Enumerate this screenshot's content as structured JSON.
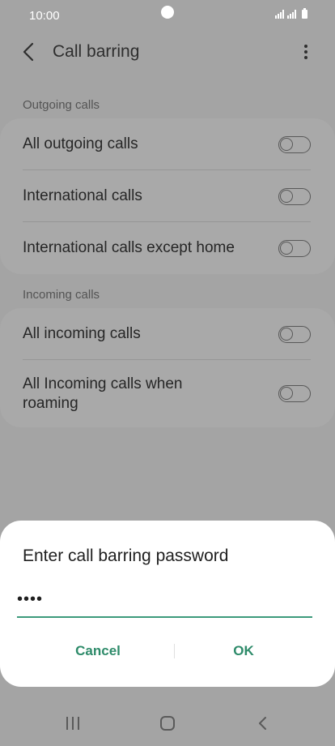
{
  "status_bar": {
    "time": "10:00"
  },
  "header": {
    "title": "Call barring"
  },
  "outgoing": {
    "section_title": "Outgoing calls",
    "items": [
      {
        "label": "All outgoing calls",
        "enabled": false
      },
      {
        "label": "International calls",
        "enabled": false
      },
      {
        "label": "International calls except home",
        "enabled": false
      }
    ]
  },
  "incoming": {
    "section_title": "Incoming calls",
    "items": [
      {
        "label": "All incoming calls",
        "enabled": false
      },
      {
        "label": "All Incoming calls when roaming",
        "enabled": false
      }
    ]
  },
  "dialog": {
    "title": "Enter call barring password",
    "password_value": "••••",
    "cancel_label": "Cancel",
    "ok_label": "OK"
  },
  "colors": {
    "accent": "#2e8b6a",
    "scrim": "#a4a4a4",
    "dialog_bg": "#ffffff"
  },
  "icons": {
    "back": "chevron-left-icon",
    "more": "more-vertical-icon",
    "nav_recents": "recents-icon",
    "nav_home": "home-icon",
    "nav_back": "nav-back-icon"
  }
}
